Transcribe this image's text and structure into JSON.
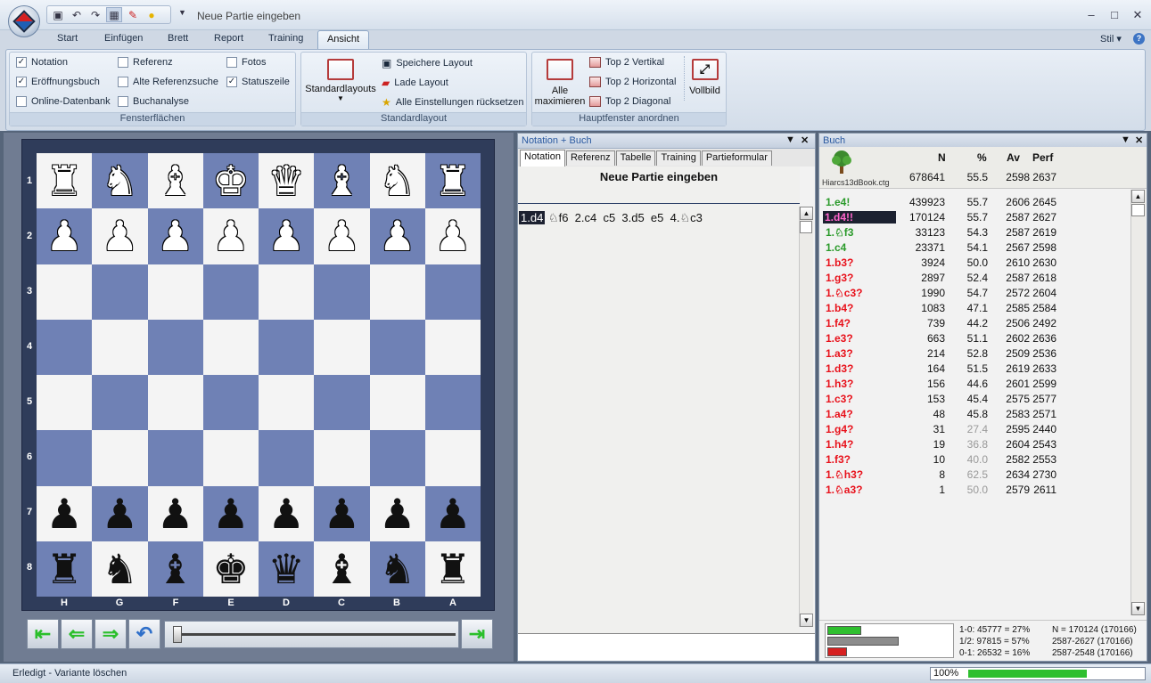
{
  "window": {
    "title": "Neue Partie eingeben"
  },
  "ribbon_tabs": [
    "Start",
    "Einfügen",
    "Brett",
    "Report",
    "Training",
    "Ansicht"
  ],
  "stil_label": "Stil",
  "help_label": "?",
  "fensterflaechen": {
    "label": "Fensterflächen",
    "items": [
      {
        "label": "Notation",
        "checked": true
      },
      {
        "label": "Referenz",
        "checked": false
      },
      {
        "label": "Fotos",
        "checked": false
      },
      {
        "label": "Eröffnungsbuch",
        "checked": true
      },
      {
        "label": "Alte Referenzsuche",
        "checked": false
      },
      {
        "label": "Statuszeile",
        "checked": true
      },
      {
        "label": "Online-Datenbank",
        "checked": false
      },
      {
        "label": "Buchanalyse",
        "checked": false
      }
    ]
  },
  "standardlayout": {
    "label": "Standardlayout",
    "big_button": "Standardlayouts",
    "small_buttons": [
      "Speichere Layout",
      "Lade Layout",
      "Alle Einstellungen rücksetzen"
    ]
  },
  "hauptfenster": {
    "label": "Hauptfenster anordnen",
    "maximize": [
      "Alle",
      "maximieren"
    ],
    "small_buttons": [
      "Top 2 Vertikal",
      "Top 2 Horizontal",
      "Top 2 Diagonal"
    ],
    "vollbild": "Vollbild"
  },
  "board": {
    "ranks": [
      "1",
      "2",
      "3",
      "4",
      "5",
      "6",
      "7",
      "8"
    ],
    "files": [
      "H",
      "G",
      "F",
      "E",
      "D",
      "C",
      "B",
      "A"
    ],
    "rows": [
      [
        "♜",
        "♞",
        "♝",
        "♚",
        "♛",
        "♝",
        "♞",
        "♜"
      ],
      [
        "♟",
        "♟",
        "♟",
        "♟",
        "♟",
        "♟",
        "♟",
        "♟"
      ],
      [
        "",
        "",
        "",
        "",
        "",
        "",
        "",
        ""
      ],
      [
        "",
        "",
        "",
        "",
        "",
        "",
        "",
        ""
      ],
      [
        "",
        "",
        "",
        "",
        "",
        "",
        "",
        ""
      ],
      [
        "",
        "",
        "",
        "",
        "",
        "",
        "",
        ""
      ],
      [
        "♟",
        "♟",
        "♟",
        "♟",
        "♟",
        "♟",
        "♟",
        "♟"
      ],
      [
        "♜",
        "♞",
        "♝",
        "♚",
        "♛",
        "♝",
        "♞",
        "♜"
      ]
    ],
    "colors": [
      "w",
      "w",
      "",
      "",
      "",
      "",
      "b",
      "b"
    ]
  },
  "notation": {
    "panel_title": "Notation + Buch",
    "tabs": [
      "Notation",
      "Referenz",
      "Tabelle",
      "Training",
      "Partieformular"
    ],
    "heading": "Neue Partie eingeben",
    "current_move": "1.d4",
    "moves": " ♘f6  2.c4  c5  3.d5  e5  4.♘c3"
  },
  "book": {
    "panel_title": "Buch",
    "book_name": "Hiarcs13dBook.ctg",
    "columns": [
      "N",
      "%",
      "Av",
      "Perf"
    ],
    "total": {
      "n": "678641",
      "pct": "55.5",
      "av": "2598",
      "perf": "2637"
    },
    "rows": [
      {
        "move": "1.e4!",
        "n": "439923",
        "pct": "55.7",
        "av": "2606",
        "perf": "2645",
        "color": "green"
      },
      {
        "move": "1.d4!!",
        "n": "170124",
        "pct": "55.7",
        "av": "2587",
        "perf": "2627",
        "color": "sel"
      },
      {
        "move": "1.♘f3",
        "n": "33123",
        "pct": "54.3",
        "av": "2587",
        "perf": "2619",
        "color": "green"
      },
      {
        "move": "1.c4",
        "n": "23371",
        "pct": "54.1",
        "av": "2567",
        "perf": "2598",
        "color": "green"
      },
      {
        "move": "1.b3?",
        "n": "3924",
        "pct": "50.0",
        "av": "2610",
        "perf": "2630",
        "color": "red"
      },
      {
        "move": "1.g3?",
        "n": "2897",
        "pct": "52.4",
        "av": "2587",
        "perf": "2618",
        "color": "red"
      },
      {
        "move": "1.♘c3?",
        "n": "1990",
        "pct": "54.7",
        "av": "2572",
        "perf": "2604",
        "color": "red"
      },
      {
        "move": "1.b4?",
        "n": "1083",
        "pct": "47.1",
        "av": "2585",
        "perf": "2584",
        "color": "red"
      },
      {
        "move": "1.f4?",
        "n": "739",
        "pct": "44.2",
        "av": "2506",
        "perf": "2492",
        "color": "red"
      },
      {
        "move": "1.e3?",
        "n": "663",
        "pct": "51.1",
        "av": "2602",
        "perf": "2636",
        "color": "red"
      },
      {
        "move": "1.a3?",
        "n": "214",
        "pct": "52.8",
        "av": "2509",
        "perf": "2536",
        "color": "red"
      },
      {
        "move": "1.d3?",
        "n": "164",
        "pct": "51.5",
        "av": "2619",
        "perf": "2633",
        "color": "red"
      },
      {
        "move": "1.h3?",
        "n": "156",
        "pct": "44.6",
        "av": "2601",
        "perf": "2599",
        "color": "red"
      },
      {
        "move": "1.c3?",
        "n": "153",
        "pct": "45.4",
        "av": "2575",
        "perf": "2577",
        "color": "red"
      },
      {
        "move": "1.a4?",
        "n": "48",
        "pct": "45.8",
        "av": "2583",
        "perf": "2571",
        "color": "red"
      },
      {
        "move": "1.g4?",
        "n": "31",
        "pct": "27.4",
        "av": "2595",
        "perf": "2440",
        "color": "red",
        "grey": true
      },
      {
        "move": "1.h4?",
        "n": "19",
        "pct": "36.8",
        "av": "2604",
        "perf": "2543",
        "color": "red",
        "grey": true
      },
      {
        "move": "1.f3?",
        "n": "10",
        "pct": "40.0",
        "av": "2582",
        "perf": "2553",
        "color": "red",
        "grey": true
      },
      {
        "move": "1.♘h3?",
        "n": "8",
        "pct": "62.5",
        "av": "2634",
        "perf": "2730",
        "color": "red",
        "grey": true
      },
      {
        "move": "1.♘a3?",
        "n": "1",
        "pct": "50.0",
        "av": "2579",
        "perf": "2611",
        "color": "red",
        "grey": true
      }
    ],
    "stats": {
      "w": "1-0:  45777 = 27%",
      "d": "1/2:  97815 = 57%",
      "l": "0-1:  26532 = 16%",
      "w_frac": 0.27,
      "d_frac": 0.57,
      "l_frac": 0.16,
      "n": "N = 170124 (170166)",
      "r1": "2587-2627 (170166)",
      "r2": "2587-2548 (170166)"
    }
  },
  "status": {
    "text": "Erledigt - Variante löschen",
    "zoom": "100%",
    "zoom_frac": 0.55
  }
}
